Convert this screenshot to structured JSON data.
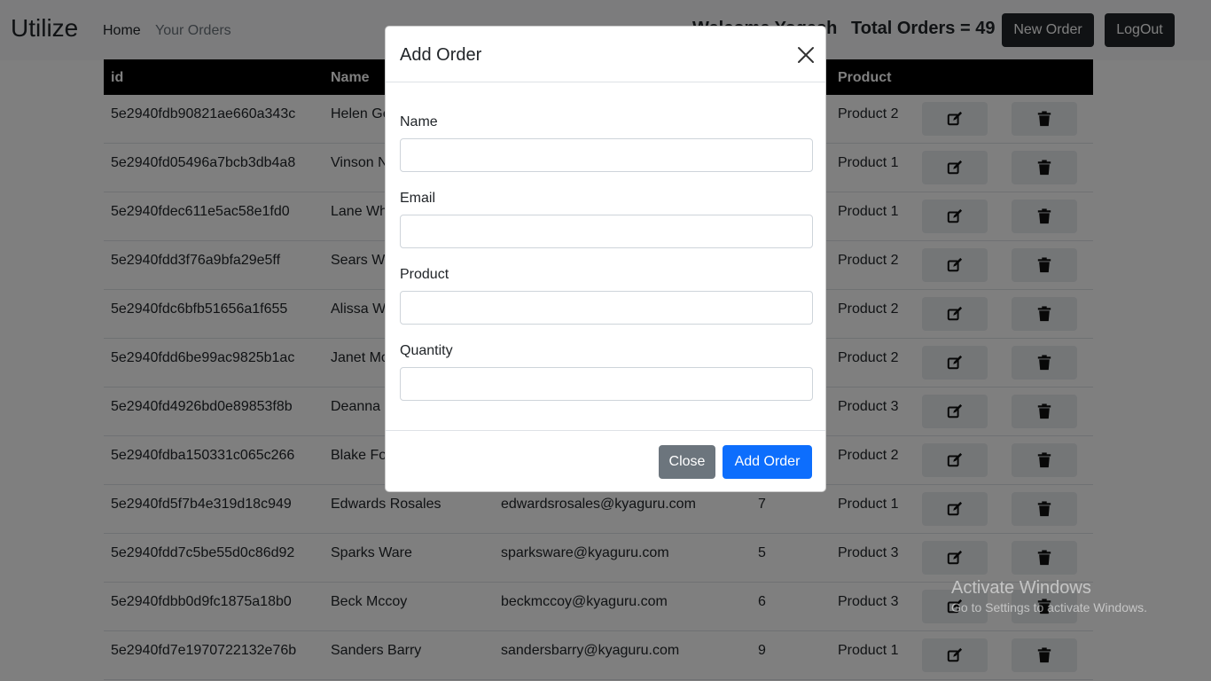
{
  "navbar": {
    "brand": "Utilize",
    "links": [
      "Home",
      "Your Orders"
    ],
    "welcome": "Welcome Yogesh",
    "total_orders": "Total Orders = 49",
    "new_order_label": "New Order",
    "logout_label": "LogOut"
  },
  "table": {
    "headers": [
      "id",
      "Name",
      "",
      "",
      "Product"
    ],
    "rows": [
      {
        "id": "5e2940fdb90821ae660a343c",
        "name": "Helen Ge",
        "email": "",
        "qty": "",
        "product": "Product 2"
      },
      {
        "id": "5e2940fd05496a7bcb3db4a8",
        "name": "Vinson N",
        "email": "",
        "qty": "",
        "product": "Product 1"
      },
      {
        "id": "5e2940fdec611e5ac58e1fd0",
        "name": "Lane Wh",
        "email": "",
        "qty": "",
        "product": "Product 1"
      },
      {
        "id": "5e2940fdd3f76a9bfa29e5ff",
        "name": "Sears Wa",
        "email": "",
        "qty": "",
        "product": "Product 2"
      },
      {
        "id": "5e2940fdc6bfb51656a1f655",
        "name": "Alissa Wi",
        "email": "",
        "qty": "",
        "product": "Product 2"
      },
      {
        "id": "5e2940fdd6be99ac9825b1ac",
        "name": "Janet Mo",
        "email": "",
        "qty": "",
        "product": "Product 2"
      },
      {
        "id": "5e2940fd4926bd0e89853f8b",
        "name": "Deanna",
        "email": "",
        "qty": "",
        "product": "Product 3"
      },
      {
        "id": "5e2940fdba150331c065c266",
        "name": "Blake Fo",
        "email": "",
        "qty": "",
        "product": "Product 2"
      },
      {
        "id": "5e2940fd5f7b4e319d18c949",
        "name": "Edwards Rosales",
        "email": "edwardsrosales@kyaguru.com",
        "qty": "7",
        "product": "Product 1"
      },
      {
        "id": "5e2940fdd7c5be55d0c86d92",
        "name": "Sparks Ware",
        "email": "sparksware@kyaguru.com",
        "qty": "5",
        "product": "Product 3"
      },
      {
        "id": "5e2940fdbb0d9fc1875a18b0",
        "name": "Beck Mccoy",
        "email": "beckmccoy@kyaguru.com",
        "qty": "6",
        "product": "Product 3"
      },
      {
        "id": "5e2940fd7e1970722132e76b",
        "name": "Sanders Barry",
        "email": "sandersbarry@kyaguru.com",
        "qty": "9",
        "product": "Product 1"
      }
    ]
  },
  "modal": {
    "title": "Add Order",
    "fields": [
      {
        "label": "Name",
        "value": ""
      },
      {
        "label": "Email",
        "value": ""
      },
      {
        "label": "Product",
        "value": ""
      },
      {
        "label": "Quantity",
        "value": ""
      }
    ],
    "close_label": "Close",
    "submit_label": "Add Order"
  },
  "watermark": {
    "line1": "Activate Windows",
    "line2": "Go to Settings to activate Windows."
  },
  "colors": {
    "primary": "#0d6efd",
    "secondary": "#6c757d",
    "dark": "#212529"
  },
  "icons": {
    "edit": "edit-icon",
    "delete": "trash-icon",
    "close": "close-icon"
  }
}
